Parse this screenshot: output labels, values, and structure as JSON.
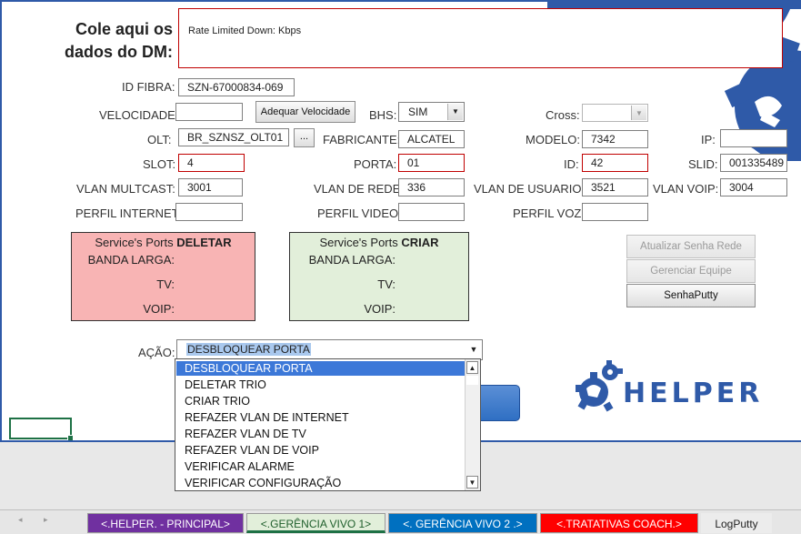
{
  "header": {
    "prompt_line1": "Cole aqui os",
    "prompt_line2": "dados do DM:",
    "paste_text": "Rate Limited Down: Kbps"
  },
  "labels": {
    "id_fibra": "ID FIBRA:",
    "velocidade": "VELOCIDADE:",
    "bhs": "BHS:",
    "cross": "Cross:",
    "olt": "OLT:",
    "fabricante": "FABRICANTE:",
    "modelo": "MODELO:",
    "ip": "IP:",
    "slot": "SLOT:",
    "porta": "PORTA:",
    "id": "ID:",
    "slid": "SLID:",
    "vlan_multcast": "VLAN MULTCAST:",
    "vlan_rede": "VLAN DE REDE:",
    "vlan_usuario": "VLAN DE USUARIO:",
    "vlan_voip": "VLAN VOIP:",
    "perfil_internet": "PERFIL INTERNET:",
    "perfil_video": "PERFIL VIDEO:",
    "perfil_voz": "PERFIL VOZ:",
    "acao": "AÇÃO:"
  },
  "values": {
    "id_fibra": "SZN-67000834-069",
    "velocidade": "",
    "bhs": "SIM",
    "cross": "",
    "olt": "BR_SZNSZ_OLT01",
    "fabricante": "ALCATEL",
    "modelo": "7342",
    "ip": "",
    "slot": "4",
    "porta": "01",
    "id": "42",
    "slid": "001335489",
    "vlan_multcast": "3001",
    "vlan_rede": "336",
    "vlan_usuario": "3521",
    "vlan_voip": "3004",
    "perfil_internet": "",
    "perfil_video": "",
    "perfil_voz": ""
  },
  "buttons": {
    "adequar": "Adequar Velocidade",
    "olt_browse": "...",
    "atualizar": "Atualizar Senha Rede",
    "gerenciar": "Gerenciar Equipe",
    "senhaputty": "SenhaPutty"
  },
  "panel_deletar": {
    "title_prefix": "Service's Ports ",
    "title_bold": "DELETAR",
    "banda": "BANDA LARGA:",
    "tv": "TV:",
    "voip": "VOIP:"
  },
  "panel_criar": {
    "title_prefix": "Service's Ports ",
    "title_bold": "CRIAR",
    "banda": "BANDA LARGA:",
    "tv": "TV:",
    "voip": "VOIP:"
  },
  "acao": {
    "selected": "DESBLOQUEAR PORTA",
    "options": [
      "DESBLOQUEAR PORTA",
      "DELETAR TRIO",
      "CRIAR TRIO",
      "REFAZER VLAN DE INTERNET",
      "REFAZER VLAN DE TV",
      "REFAZER VLAN DE VOIP",
      "VERIFICAR ALARME",
      "VERIFICAR CONFIGURAÇÃO"
    ]
  },
  "logo": {
    "text": "HELPER"
  },
  "tabs": {
    "t1": "<.HELPER. - PRINCIPAL>",
    "t2": "<.GERÊNCIA VIVO 1>",
    "t3": "<. GERÊNCIA VIVO 2 .>",
    "t4": "<.TRATATIVAS COACH.>",
    "t5": "LogPutty"
  },
  "colors": {
    "panel_deletar_bg": "#f8b4b4",
    "panel_criar_bg": "#e2efda",
    "tab1": "#7030a0",
    "tab3": "#0070c0",
    "tab4": "#ff0000",
    "brand": "#2f5aa8"
  }
}
